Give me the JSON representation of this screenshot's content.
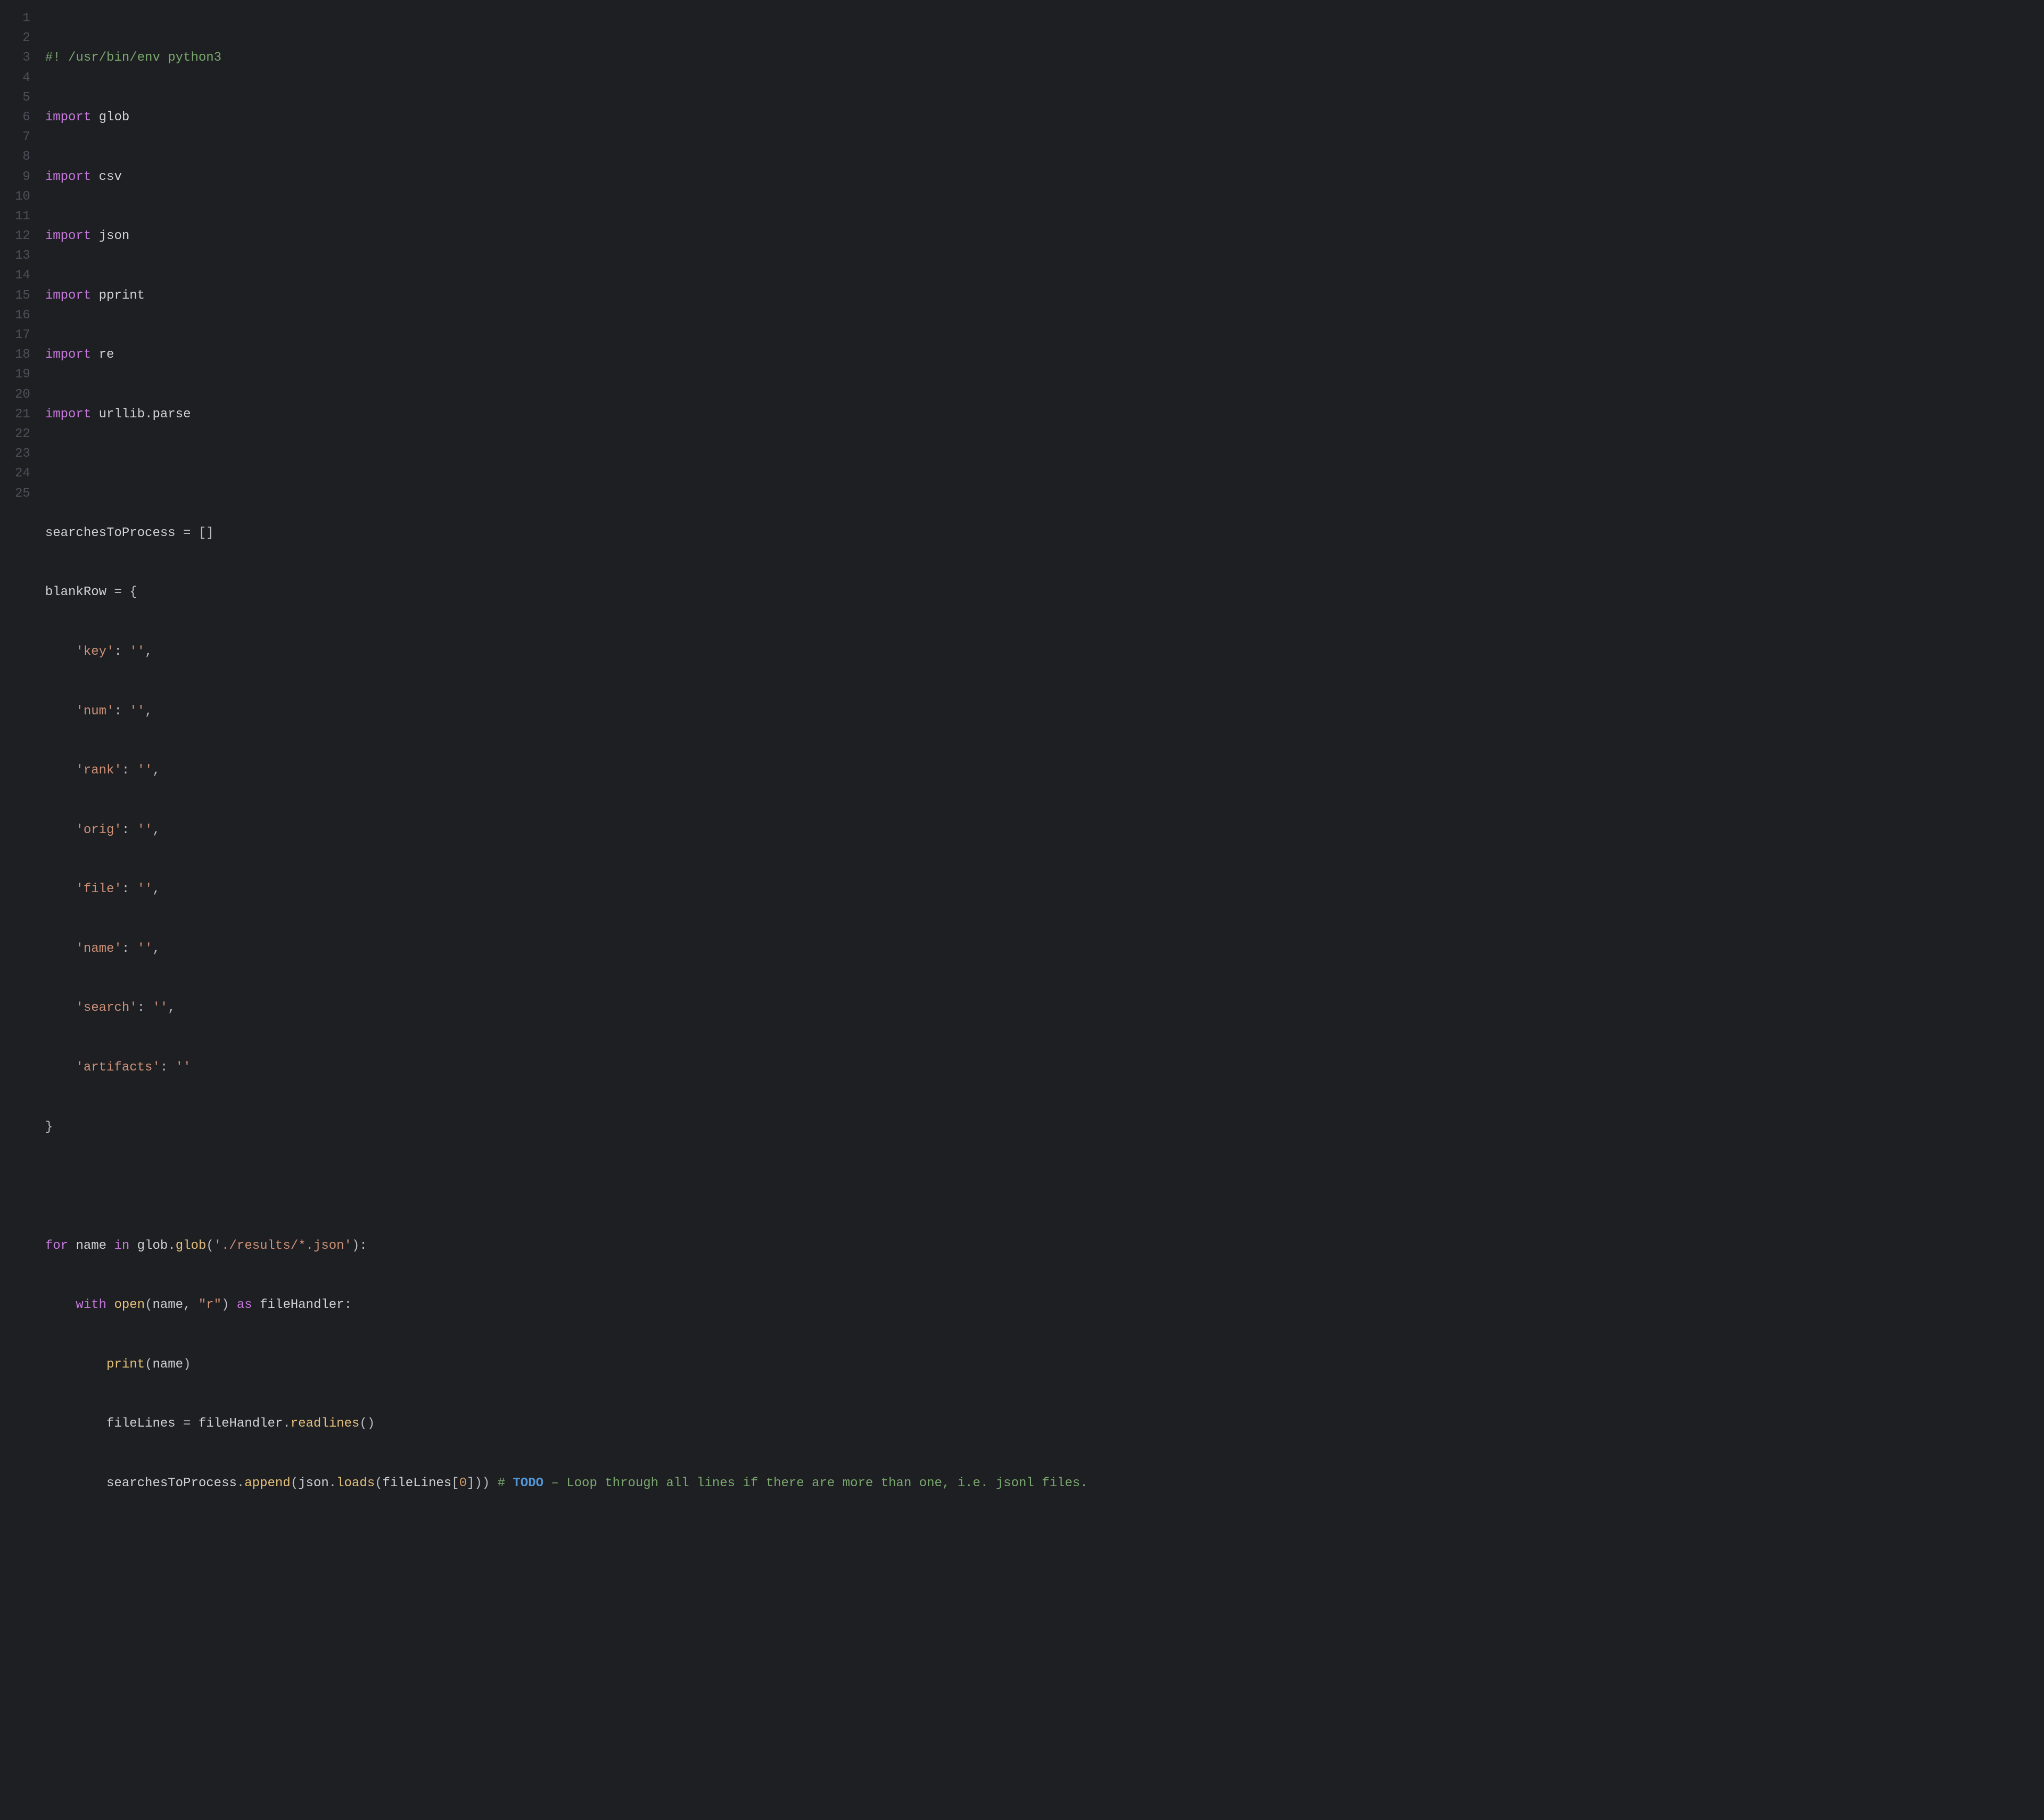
{
  "language": "python",
  "line_numbers": [
    "1",
    "2",
    "3",
    "4",
    "5",
    "6",
    "7",
    "8",
    "9",
    "10",
    "11",
    "12",
    "13",
    "14",
    "15",
    "16",
    "17",
    "18",
    "19",
    "20",
    "21",
    "22",
    "23",
    "24",
    "25",
    ""
  ],
  "code": {
    "shebang": "#! /usr/bin/env python3",
    "kw_import": "import",
    "imports": [
      "glob",
      "csv",
      "json",
      "pprint",
      "re",
      "urllib.parse"
    ],
    "var_searches": "searchesToProcess",
    "empty_list": "[]",
    "assign": " = ",
    "var_blankRow": "blankRow",
    "brace_open": "{",
    "brace_close": "}",
    "dict_entries": [
      {
        "key": "'key'",
        "sep": ": ",
        "val": "''",
        "comma": ","
      },
      {
        "key": "'num'",
        "sep": ": ",
        "val": "''",
        "comma": ","
      },
      {
        "key": "'rank'",
        "sep": ": ",
        "val": "''",
        "comma": ","
      },
      {
        "key": "'orig'",
        "sep": ": ",
        "val": "''",
        "comma": ","
      },
      {
        "key": "'file'",
        "sep": ": ",
        "val": "''",
        "comma": ","
      },
      {
        "key": "'name'",
        "sep": ": ",
        "val": "''",
        "comma": ","
      },
      {
        "key": "'search'",
        "sep": ": ",
        "val": "''",
        "comma": ","
      },
      {
        "key": "'artifacts'",
        "sep": ": ",
        "val": "''",
        "comma": ""
      }
    ],
    "kw_for": "for",
    "kw_in": "in",
    "kw_with": "with",
    "kw_as": "as",
    "id_name": "name",
    "id_glob": "glob",
    "id_glob2": "glob",
    "str_resultsPath": "'./results/*.json'",
    "paren_close_colon": "):",
    "call_open_paren": "(",
    "call_open": "open",
    "open_args_sep": ", ",
    "str_r": "\"r\"",
    "id_fileHandler": "fileHandler",
    "colon": ":",
    "call_print": "print",
    "print_arg": "name",
    "id_fileLines": "fileLines",
    "dot": ".",
    "call_readlines": "readlines",
    "empty_parens": "()",
    "id_searchesToProcess": "searchesToProcess",
    "call_append": "append",
    "id_json": "json",
    "call_loads": "loads",
    "id_fileLines2": "fileLines",
    "sq_open": "[",
    "num_zero": "0",
    "sq_close_parens": "])) ",
    "hash": "# ",
    "todo": "TODO",
    "todo_dash": " – ",
    "todo_rest": "Loop through all lines if there are more than one, i.e. jsonl files."
  }
}
